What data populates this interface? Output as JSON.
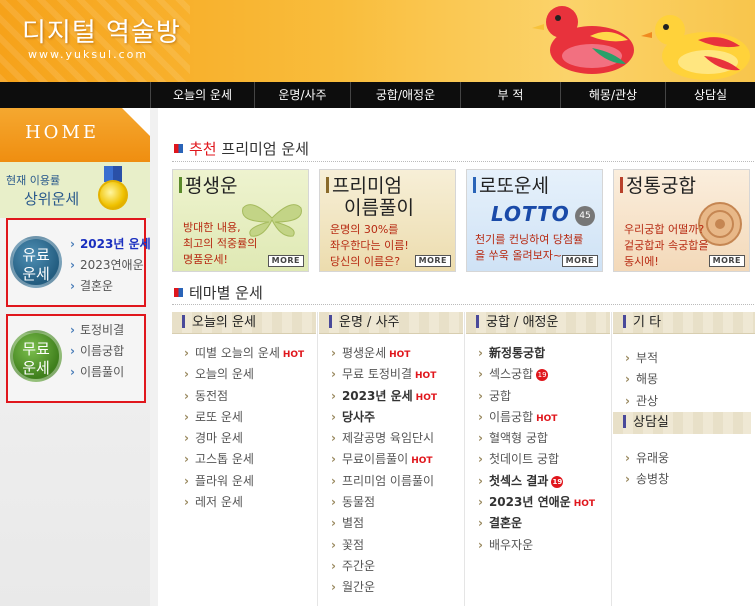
{
  "header": {
    "title": "디지털 역술방",
    "url": "www.yuksul.com"
  },
  "nav": [
    "오늘의 운세",
    "운명/사주",
    "궁합/애정운",
    "부 적",
    "해몽/관상",
    "상담실"
  ],
  "sidebar": {
    "home": "HOME",
    "rank_line1": "현재 이용률",
    "rank_line2": "상위운세",
    "paid": {
      "label_top": "유료",
      "label_bottom": "운세",
      "items": [
        "2023년 운세",
        "2023연애운",
        "결혼운"
      ]
    },
    "free": {
      "label_top": "무료",
      "label_bottom": "운세",
      "items": [
        "토정비결",
        "이름궁합",
        "이름풀이"
      ]
    }
  },
  "premium": {
    "title_highlight": "추천",
    "title": "프리미엄 운세",
    "more": "MORE",
    "cards": [
      {
        "title": "평생운",
        "desc": [
          "방대한 내용,",
          "최고의 적중률의",
          "명품운세!"
        ]
      },
      {
        "title": "프리미엄",
        "title2": "이름풀이",
        "desc": [
          "운명의 30%를",
          "좌우한다는 이름!",
          "당신의 이름은?"
        ]
      },
      {
        "title": "로또운세",
        "logo": "LOTTO",
        "ball": "45",
        "desc": [
          "천기를 컨닝하여 당첨률",
          "을 쑤욱 올려보자~"
        ]
      },
      {
        "title": "정통궁합",
        "desc": [
          "우리궁합 어떨까?",
          "겉궁합과 속궁합을",
          "동시에!"
        ]
      }
    ]
  },
  "theme": {
    "title": "테마별 운세",
    "hot": "HOT",
    "age": "19",
    "columns": [
      {
        "head": "오늘의 운세",
        "items": [
          {
            "t": "띠별 오늘의 운세",
            "hot": true
          },
          {
            "t": "오늘의 운세"
          },
          {
            "t": "동전점"
          },
          {
            "t": "로또 운세"
          },
          {
            "t": "경마 운세"
          },
          {
            "t": "고스톱 운세"
          },
          {
            "t": "플라워 운세"
          },
          {
            "t": "레저 운세"
          }
        ]
      },
      {
        "head": "운명 / 사주",
        "items": [
          {
            "t": "평생운세",
            "hot": true
          },
          {
            "t": "무료 토정비결",
            "hot": true
          },
          {
            "t": "2023년 운세",
            "hot": true,
            "b": true
          },
          {
            "t": "당사주",
            "b": true
          },
          {
            "t": "제갈공명 육임단시"
          },
          {
            "t": "무료이름풀이",
            "hot": true
          },
          {
            "t": "프리미엄 이름풀이"
          },
          {
            "t": "동물점"
          },
          {
            "t": "별점"
          },
          {
            "t": "꽃점"
          },
          {
            "t": "주간운"
          },
          {
            "t": "월간운"
          }
        ]
      },
      {
        "head": "궁합 / 애정운",
        "items": [
          {
            "t": "新정통궁합",
            "b": true
          },
          {
            "t": "섹스궁합",
            "age": true
          },
          {
            "t": "궁합"
          },
          {
            "t": "이름궁합",
            "hot": true
          },
          {
            "t": "혈액형 궁합"
          },
          {
            "t": "첫데이트 궁합"
          },
          {
            "t": "첫섹스 결과",
            "age": true,
            "b": true
          },
          {
            "t": "2023년 연애운",
            "hot": true,
            "b": true
          },
          {
            "t": "결혼운",
            "b": true
          },
          {
            "t": "배우자운"
          }
        ]
      },
      {
        "head": "기   타",
        "items": [
          {
            "t": "부적"
          },
          {
            "t": "해몽"
          },
          {
            "t": "관상"
          }
        ],
        "sub_head": "상담실",
        "sub_items": [
          {
            "t": "유래웅"
          },
          {
            "t": "송병창"
          }
        ]
      }
    ]
  },
  "colors": {
    "accent_red": "#e0161c",
    "nav_bg": "#0d0d0d",
    "header_orange": "#f6a21a"
  }
}
